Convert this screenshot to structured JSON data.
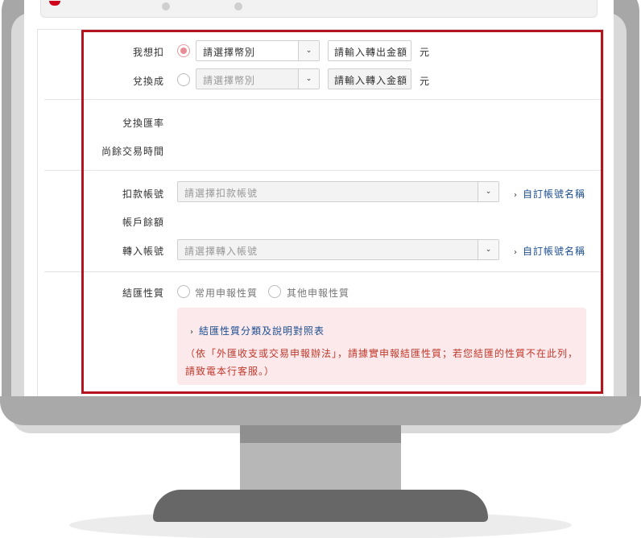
{
  "form": {
    "debit_label": "我想扣",
    "debit_currency_placeholder": "請選擇幣別",
    "debit_amount_placeholder": "請輸入轉出金額",
    "debit_unit": "元",
    "credit_label": "兌換成",
    "credit_currency_placeholder": "請選擇幣別",
    "credit_amount_placeholder": "請輸入轉入金額",
    "credit_unit": "元",
    "rate_label": "兌換匯率",
    "remaining_time_label": "尚餘交易時間",
    "debit_account_label": "扣款帳號",
    "debit_account_placeholder": "請選擇扣款帳號",
    "custom_account_link": "自訂帳號名稱",
    "balance_label": "帳戶餘額",
    "credit_account_label": "轉入帳號",
    "credit_account_placeholder": "請選擇轉入帳號",
    "custom_account_link2": "自訂帳號名稱",
    "remit_type_label": "結匯性質",
    "remit_option_common": "常用申報性質",
    "remit_option_other": "其他申報性質",
    "remit_table_link": "結匯性質分類及說明對照表",
    "notice_text": "（依「外匯收支或交易申報辦法」，請據實申報結匯性質；若您結匯的性質不在此列，請致電本行客服。）"
  },
  "icons": {
    "dropdown": "chevron-down-icon",
    "link_arrow": "chevron-right-icon"
  },
  "colors": {
    "highlight": "#b3141d",
    "link": "#1d4e8f",
    "notice_bg": "#fbe9ec",
    "notice_text": "#c0392b"
  }
}
